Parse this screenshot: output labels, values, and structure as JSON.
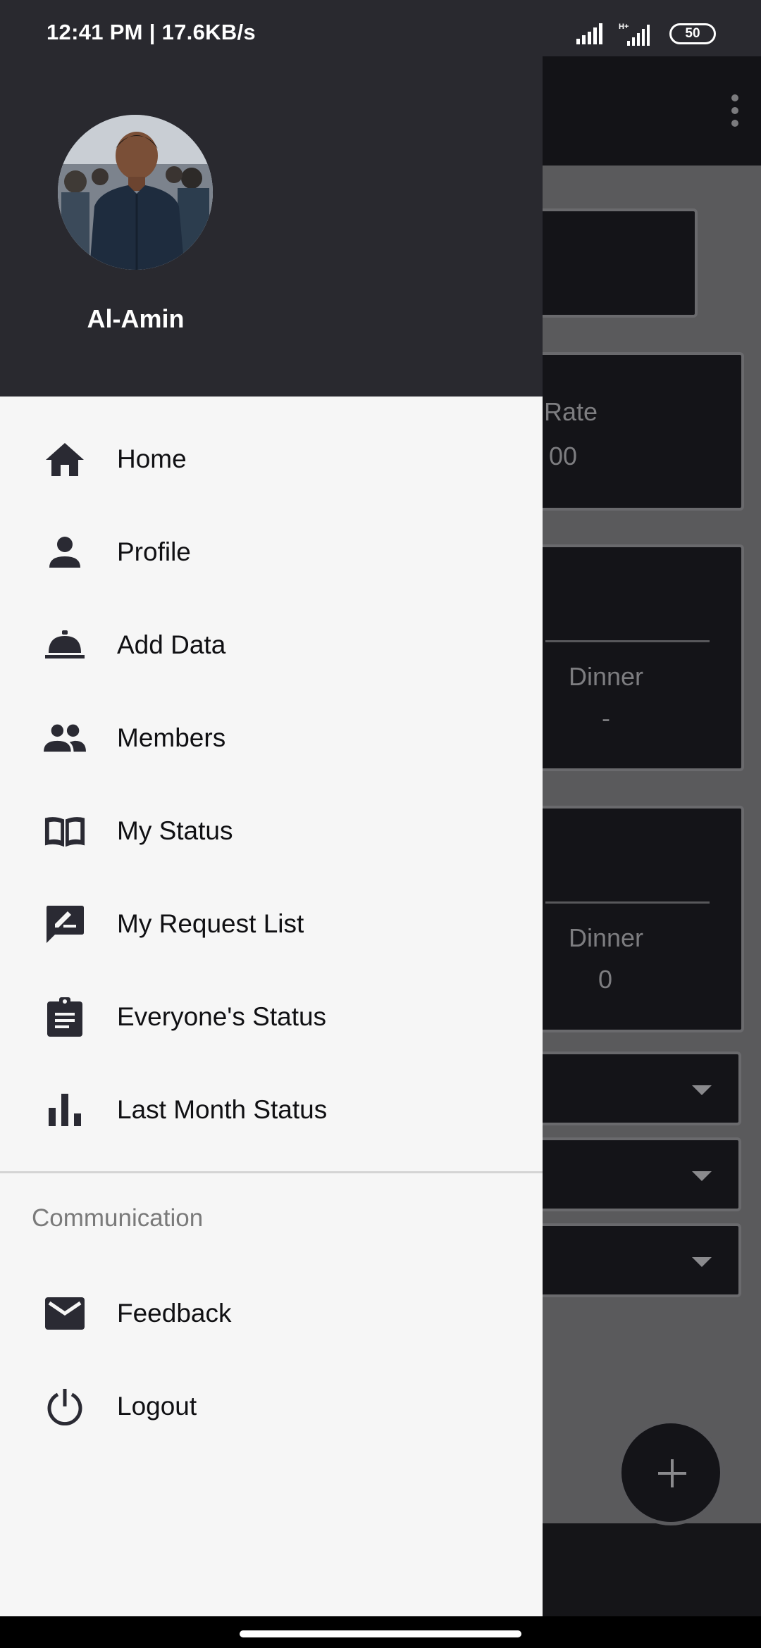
{
  "status_bar": {
    "time": "12:41 PM | 17.6KB/s",
    "battery": "50",
    "network_label": "H+"
  },
  "background_app": {
    "rate_label": "l Rate",
    "rate_value": "00",
    "card2_label": "Dinner",
    "card2_value": "-",
    "card3_label": "Dinner",
    "card3_value": "0"
  },
  "drawer": {
    "user_name": "Al-Amin",
    "menu_items": [
      {
        "label": "Home",
        "icon": "home-icon"
      },
      {
        "label": "Profile",
        "icon": "person-icon"
      },
      {
        "label": "Add Data",
        "icon": "room-service-icon"
      },
      {
        "label": "Members",
        "icon": "people-icon"
      },
      {
        "label": "My Status",
        "icon": "book-icon"
      },
      {
        "label": "My Request List",
        "icon": "rate-review-icon"
      },
      {
        "label": "Everyone's Status",
        "icon": "assignment-icon"
      },
      {
        "label": "Last Month Status",
        "icon": "bar-chart-icon"
      }
    ],
    "section_title": "Communication",
    "section_items": [
      {
        "label": "Feedback",
        "icon": "mail-icon"
      },
      {
        "label": "Logout",
        "icon": "power-icon"
      }
    ]
  },
  "colors": {
    "drawer_header": "#29292f",
    "drawer_body": "#f6f6f6",
    "icon": "#2a2a33"
  }
}
